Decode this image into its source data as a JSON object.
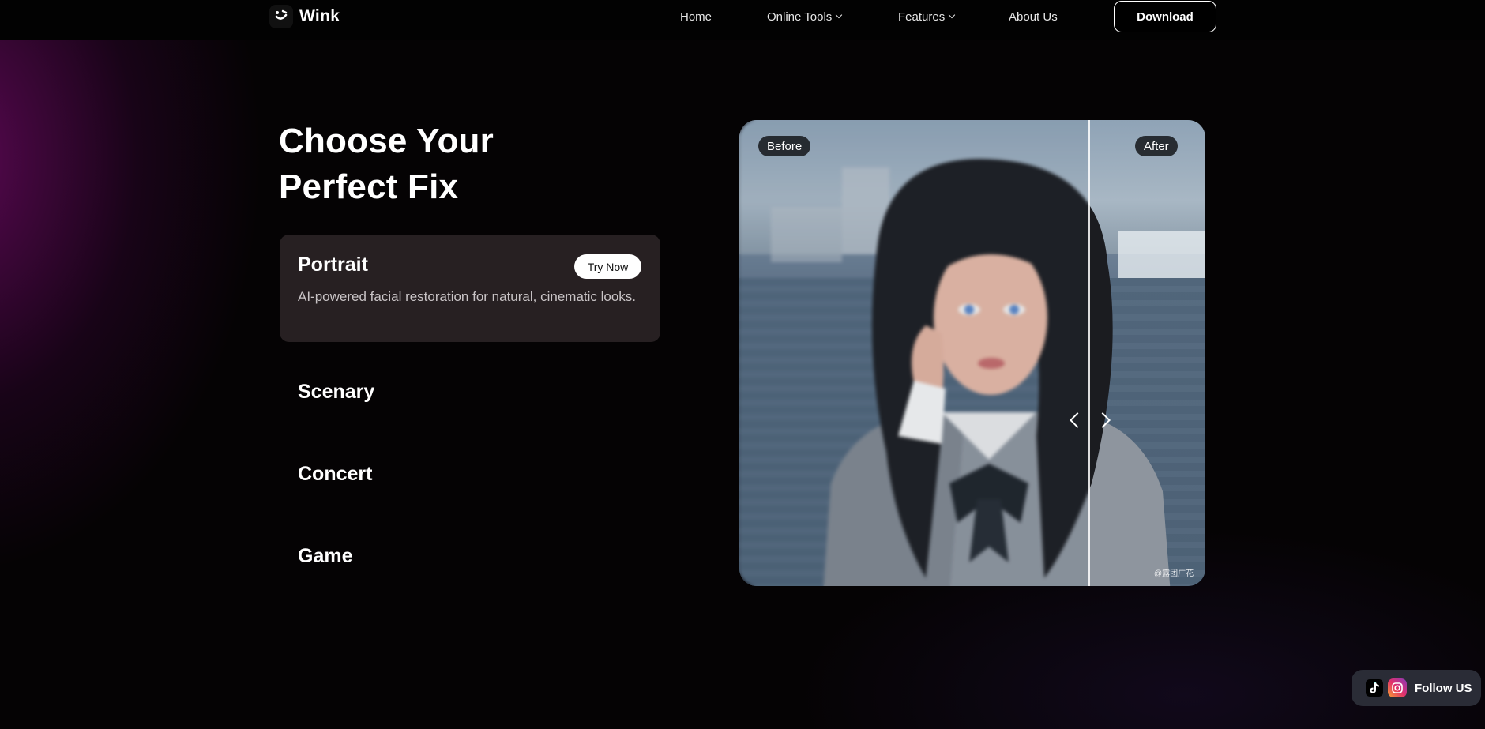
{
  "brand": {
    "name": "Wink"
  },
  "nav": {
    "items": [
      {
        "label": "Home",
        "has_dropdown": false
      },
      {
        "label": "Online Tools",
        "has_dropdown": true
      },
      {
        "label": "Features",
        "has_dropdown": true
      },
      {
        "label": "About Us",
        "has_dropdown": false
      }
    ],
    "download_label": "Download"
  },
  "hero": {
    "heading_line1": "Choose Your",
    "heading_line2": "Perfect Fix",
    "active_card": {
      "title": "Portrait",
      "button_label": "Try Now",
      "description": "AI-powered facial restoration for natural, cinematic looks."
    },
    "categories": [
      "Scenary",
      "Concert",
      "Game"
    ]
  },
  "compare": {
    "before_label": "Before",
    "after_label": "After",
    "watermark": "@露团广花",
    "divider_position": 0.75
  },
  "follow": {
    "label": "Follow US",
    "icons": [
      "tiktok-icon",
      "instagram-icon"
    ]
  },
  "colors": {
    "accent_glow": "#780a6e",
    "card_bg": "#342c2e",
    "follow_bg": "#2a2c36"
  }
}
